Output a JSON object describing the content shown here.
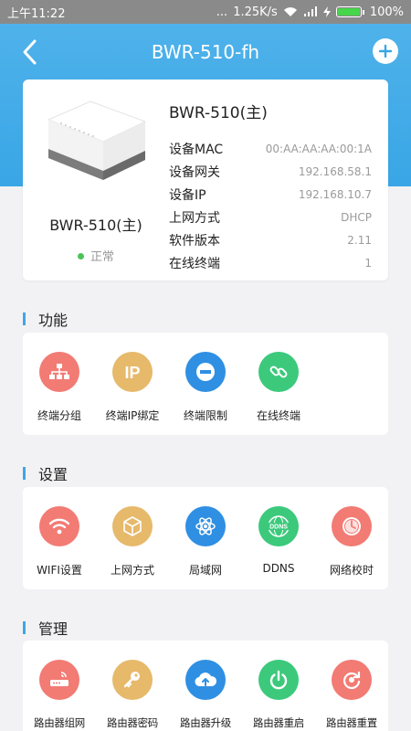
{
  "status_bar": {
    "time": "上午11:22",
    "dots": "...",
    "net_speed": "1.25K/s",
    "battery": "100%",
    "battery_level": 1.0
  },
  "header": {
    "title": "BWR-510-fh",
    "back_icon": "chevron-left-icon",
    "add_icon": "plus-circle-icon"
  },
  "device": {
    "name": "BWR-510(主)",
    "status": "正常",
    "status_color": "#4cc35a",
    "info_title": "BWR-510(主)",
    "info": [
      {
        "label": "设备MAC",
        "value": "00:AA:AA:AA:00:1A"
      },
      {
        "label": "设备网关",
        "value": "192.168.58.1"
      },
      {
        "label": "设备IP",
        "value": "192.168.10.7"
      },
      {
        "label": "上网方式",
        "value": "DHCP"
      },
      {
        "label": "软件版本",
        "value": "2.11"
      },
      {
        "label": "在线终端",
        "value": "1"
      }
    ]
  },
  "sections": {
    "functions": {
      "title": "功能",
      "items": [
        {
          "label": "终端分组",
          "icon": "sitemap-icon",
          "color": "#f27b74"
        },
        {
          "label": "终端IP绑定",
          "icon": "ip-icon",
          "color": "#e6b96b"
        },
        {
          "label": "终端限制",
          "icon": "minus-circle-icon",
          "color": "#2f8fe3"
        },
        {
          "label": "在线终端",
          "icon": "link-icon",
          "color": "#3cc97c"
        }
      ]
    },
    "settings": {
      "title": "设置",
      "items": [
        {
          "label": "WIFI设置",
          "icon": "wifi-icon",
          "color": "#f27b74"
        },
        {
          "label": "上网方式",
          "icon": "cube-icon",
          "color": "#e6b96b"
        },
        {
          "label": "局域网",
          "icon": "atom-icon",
          "color": "#2f8fe3"
        },
        {
          "label": "DDNS",
          "icon": "ddns-globe-icon",
          "color": "#3cc97c"
        },
        {
          "label": "网络校时",
          "icon": "clock-icon",
          "color": "#f27b74"
        }
      ]
    },
    "management": {
      "title": "管理",
      "items": [
        {
          "label": "路由器组网",
          "icon": "router-icon",
          "color": "#f27b74"
        },
        {
          "label": "路由器密码",
          "icon": "key-icon",
          "color": "#e6b96b"
        },
        {
          "label": "路由器升级",
          "icon": "cloud-upload-icon",
          "color": "#2f8fe3"
        },
        {
          "label": "路由器重启",
          "icon": "power-icon",
          "color": "#3cc97c"
        },
        {
          "label": "路由器重置",
          "icon": "reset-icon",
          "color": "#f27b74"
        }
      ]
    }
  }
}
